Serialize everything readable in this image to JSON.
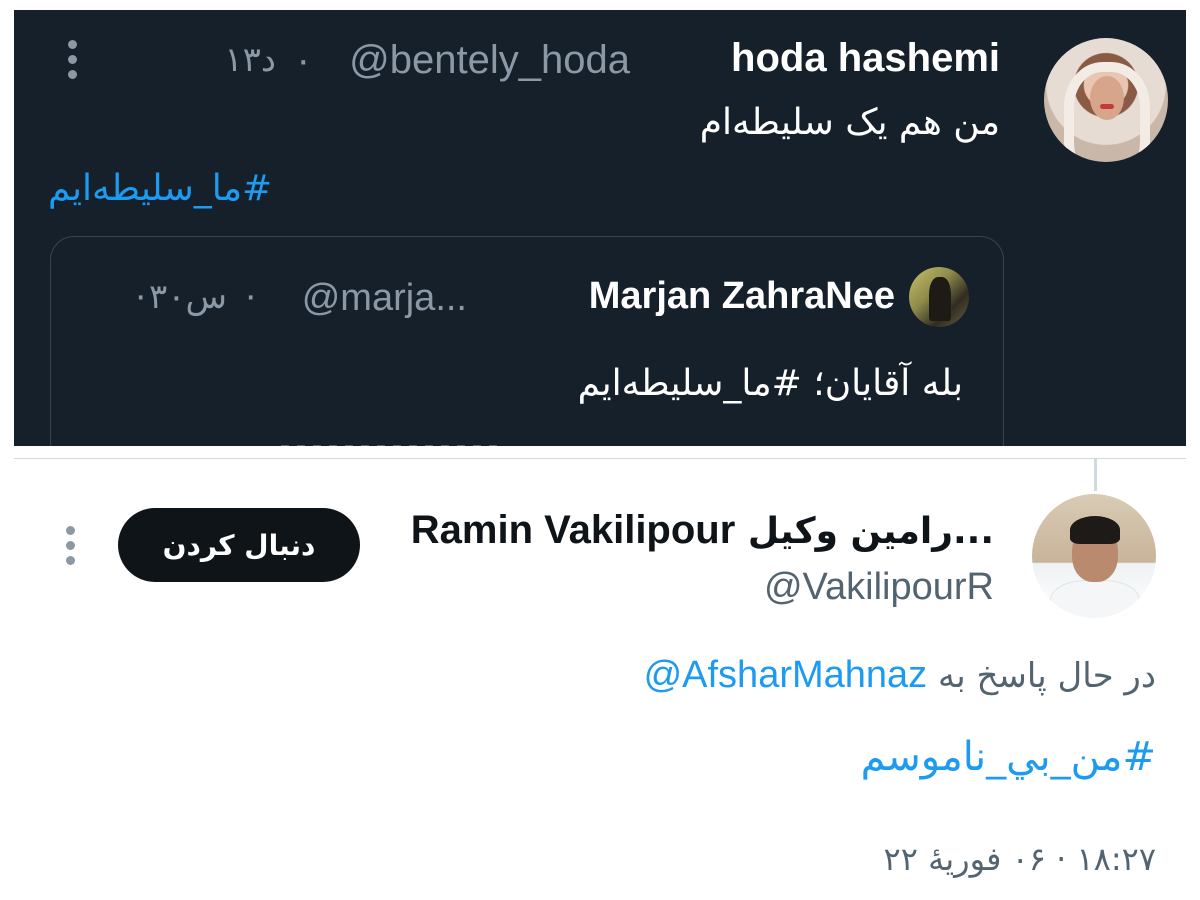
{
  "top_tweet": {
    "author_name": "hoda hashemi",
    "author_handle": "@bentely_hoda",
    "separator": "·",
    "time": "۱۳د",
    "text": "من هم یک سلیطه‌ام",
    "hashtag": "#ما_سلیطه‌ایم",
    "avatar_icon": "profile-photo-woman-headscarf",
    "more_icon": "more-vertical-icon",
    "quoted": {
      "author_name": "Marjan ZahraNee",
      "author_handle": "@marja...",
      "separator": "·",
      "time": "۳۰س",
      "trailing_separator": "·",
      "text": "بله آقایان؛ #ما_سلیطه‌ایم"
    }
  },
  "bottom_tweet": {
    "author_name_fa": "...رامین وکیل",
    "author_name_en": "Ramin Vakilipour",
    "author_handle": "@VakilipourR",
    "follow_label": "دنبال کردن",
    "reply_prefix": "در حال پاسخ به",
    "reply_mention": "@AfsharMahnaz",
    "hashtag": "#من_بي_ناموسم",
    "timestamp": "۱۸:۲۷ · ۰۶ فوریهٔ ۲۲",
    "more_icon": "more-vertical-icon"
  },
  "colors": {
    "dark_bg": "#15202b",
    "link_blue": "#1d9bf0",
    "muted_dark": "#8b98a5",
    "muted_light": "#536471",
    "button_black": "#0f1419"
  }
}
